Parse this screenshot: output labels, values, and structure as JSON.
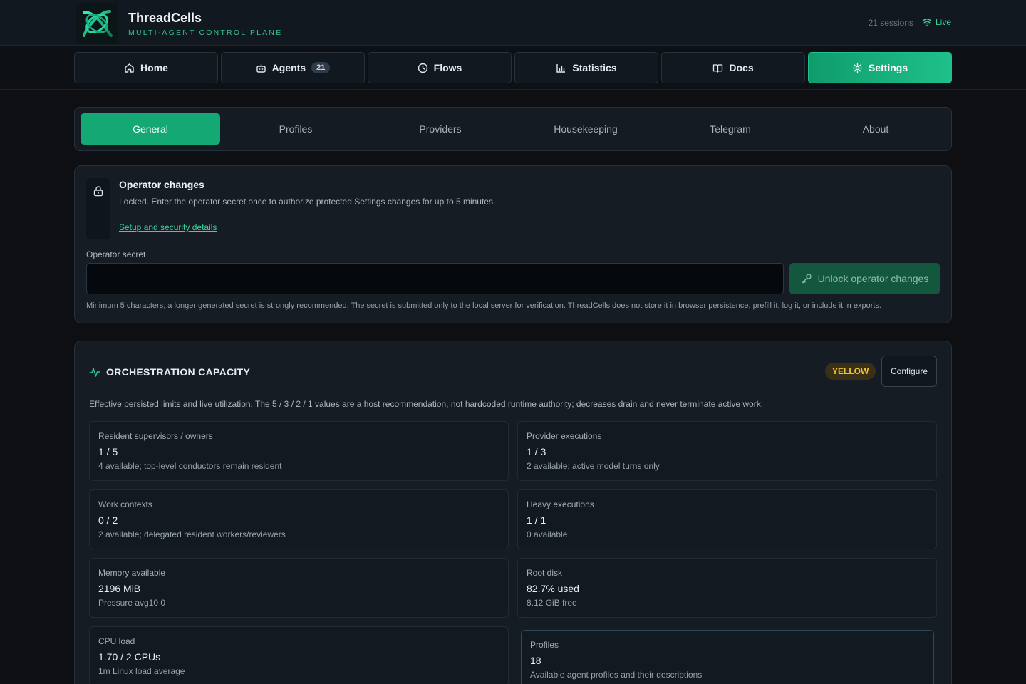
{
  "header": {
    "title": "ThreadCells",
    "subtitle": "MULTI-AGENT CONTROL PLANE",
    "sessions": "21 sessions",
    "live": "Live",
    "logo_icon": "threadcells-knot-logo",
    "accent": "#1fc08a"
  },
  "nav": {
    "home": "Home",
    "agents": "Agents",
    "agents_count": "21",
    "flows": "Flows",
    "statistics": "Statistics",
    "docs": "Docs",
    "settings": "Settings",
    "active": "Settings"
  },
  "subtabs": {
    "items": [
      "General",
      "Profiles",
      "Providers",
      "Housekeeping",
      "Telegram",
      "About"
    ],
    "active": "General"
  },
  "operator": {
    "title": "Operator changes",
    "description": "Locked. Enter the operator secret once to authorize protected Settings changes for up to 5 minutes.",
    "link": "Setup and security details",
    "secret_label": "Operator secret",
    "secret_value": "",
    "unlock_label": "Unlock operator changes",
    "hint": "Minimum 5 characters; a longer generated secret is strongly recommended. The secret is submitted only to the local server for verification. ThreadCells does not store it in browser persistence, prefill it, log it, or include it in exports."
  },
  "capacity": {
    "title": "ORCHESTRATION CAPACITY",
    "status": "YELLOW",
    "status_color": "#f0c43a",
    "configure_label": "Configure",
    "description": "Effective persisted limits and live utilization. The 5 / 3 / 2 / 1 values are a host recommendation, not hardcoded runtime authority; decreases drain and never terminate active work.",
    "metrics": [
      {
        "label": "Resident supervisors / owners",
        "value": "1 / 5",
        "sub": "4 available; top-level conductors remain resident"
      },
      {
        "label": "Provider executions",
        "value": "1 / 3",
        "sub": "2 available; active model turns only"
      },
      {
        "label": "Work contexts",
        "value": "0 / 2",
        "sub": "2 available; delegated resident workers/reviewers"
      },
      {
        "label": "Heavy executions",
        "value": "1 / 1",
        "sub": "0 available"
      },
      {
        "label": "Memory available",
        "value": "2196 MiB",
        "sub": "Pressure avg10 0"
      },
      {
        "label": "Root disk",
        "value": "82.7% used",
        "sub": "8.12 GiB free"
      },
      {
        "label": "CPU load",
        "value": "1.70 / 2 CPUs",
        "sub": "1m Linux load average"
      },
      {
        "label": "Profiles",
        "value": "18",
        "sub": "Available agent profiles and their descriptions"
      }
    ]
  }
}
